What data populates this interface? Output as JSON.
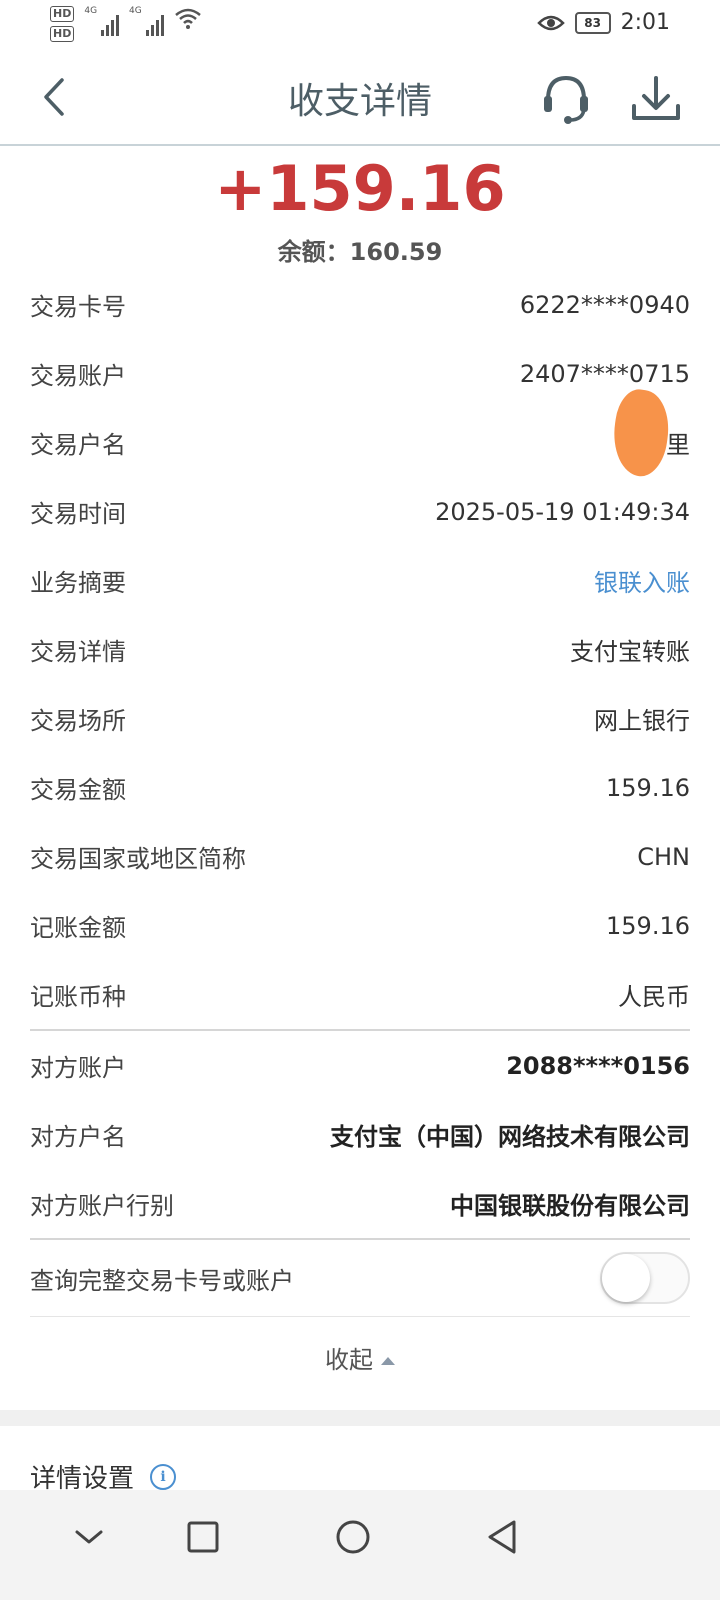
{
  "status_bar": {
    "hd1": "HD",
    "hd2": "HD",
    "net1": "4G",
    "net2": "4G",
    "battery": "83",
    "time": "2:01"
  },
  "header": {
    "title": "收支详情"
  },
  "summary": {
    "amount": "+159.16",
    "balance": "余额：160.59"
  },
  "details": [
    {
      "label": "交易卡号",
      "value": "6222****0940"
    },
    {
      "label": "交易账户",
      "value": "2407****0715"
    },
    {
      "label": "交易户名",
      "value": "谭  里"
    },
    {
      "label": "交易时间",
      "value": "2025-05-19 01:49:34"
    },
    {
      "label": "业务摘要",
      "value": "银联入账"
    },
    {
      "label": "交易详情",
      "value": "支付宝转账"
    },
    {
      "label": "交易场所",
      "value": "网上银行"
    },
    {
      "label": "交易金额",
      "value": "159.16"
    },
    {
      "label": "交易国家或地区简称",
      "value": "CHN"
    },
    {
      "label": "记账金额",
      "value": "159.16"
    },
    {
      "label": "记账币种",
      "value": "人民币"
    }
  ],
  "counterparty": [
    {
      "label": "对方账户",
      "value": "2088****0156"
    },
    {
      "label": "对方户名",
      "value": "支付宝（中国）网络技术有限公司"
    },
    {
      "label": "对方账户行别",
      "value": "中国银联股份有限公司"
    }
  ],
  "toggle": {
    "label": "查询完整交易卡号或账户",
    "on": false
  },
  "collapse_label": "收起",
  "settings_label": "详情设置",
  "colors": {
    "amount": "#c83a3a",
    "link": "#4a8fd0",
    "title": "#4d5e66"
  }
}
